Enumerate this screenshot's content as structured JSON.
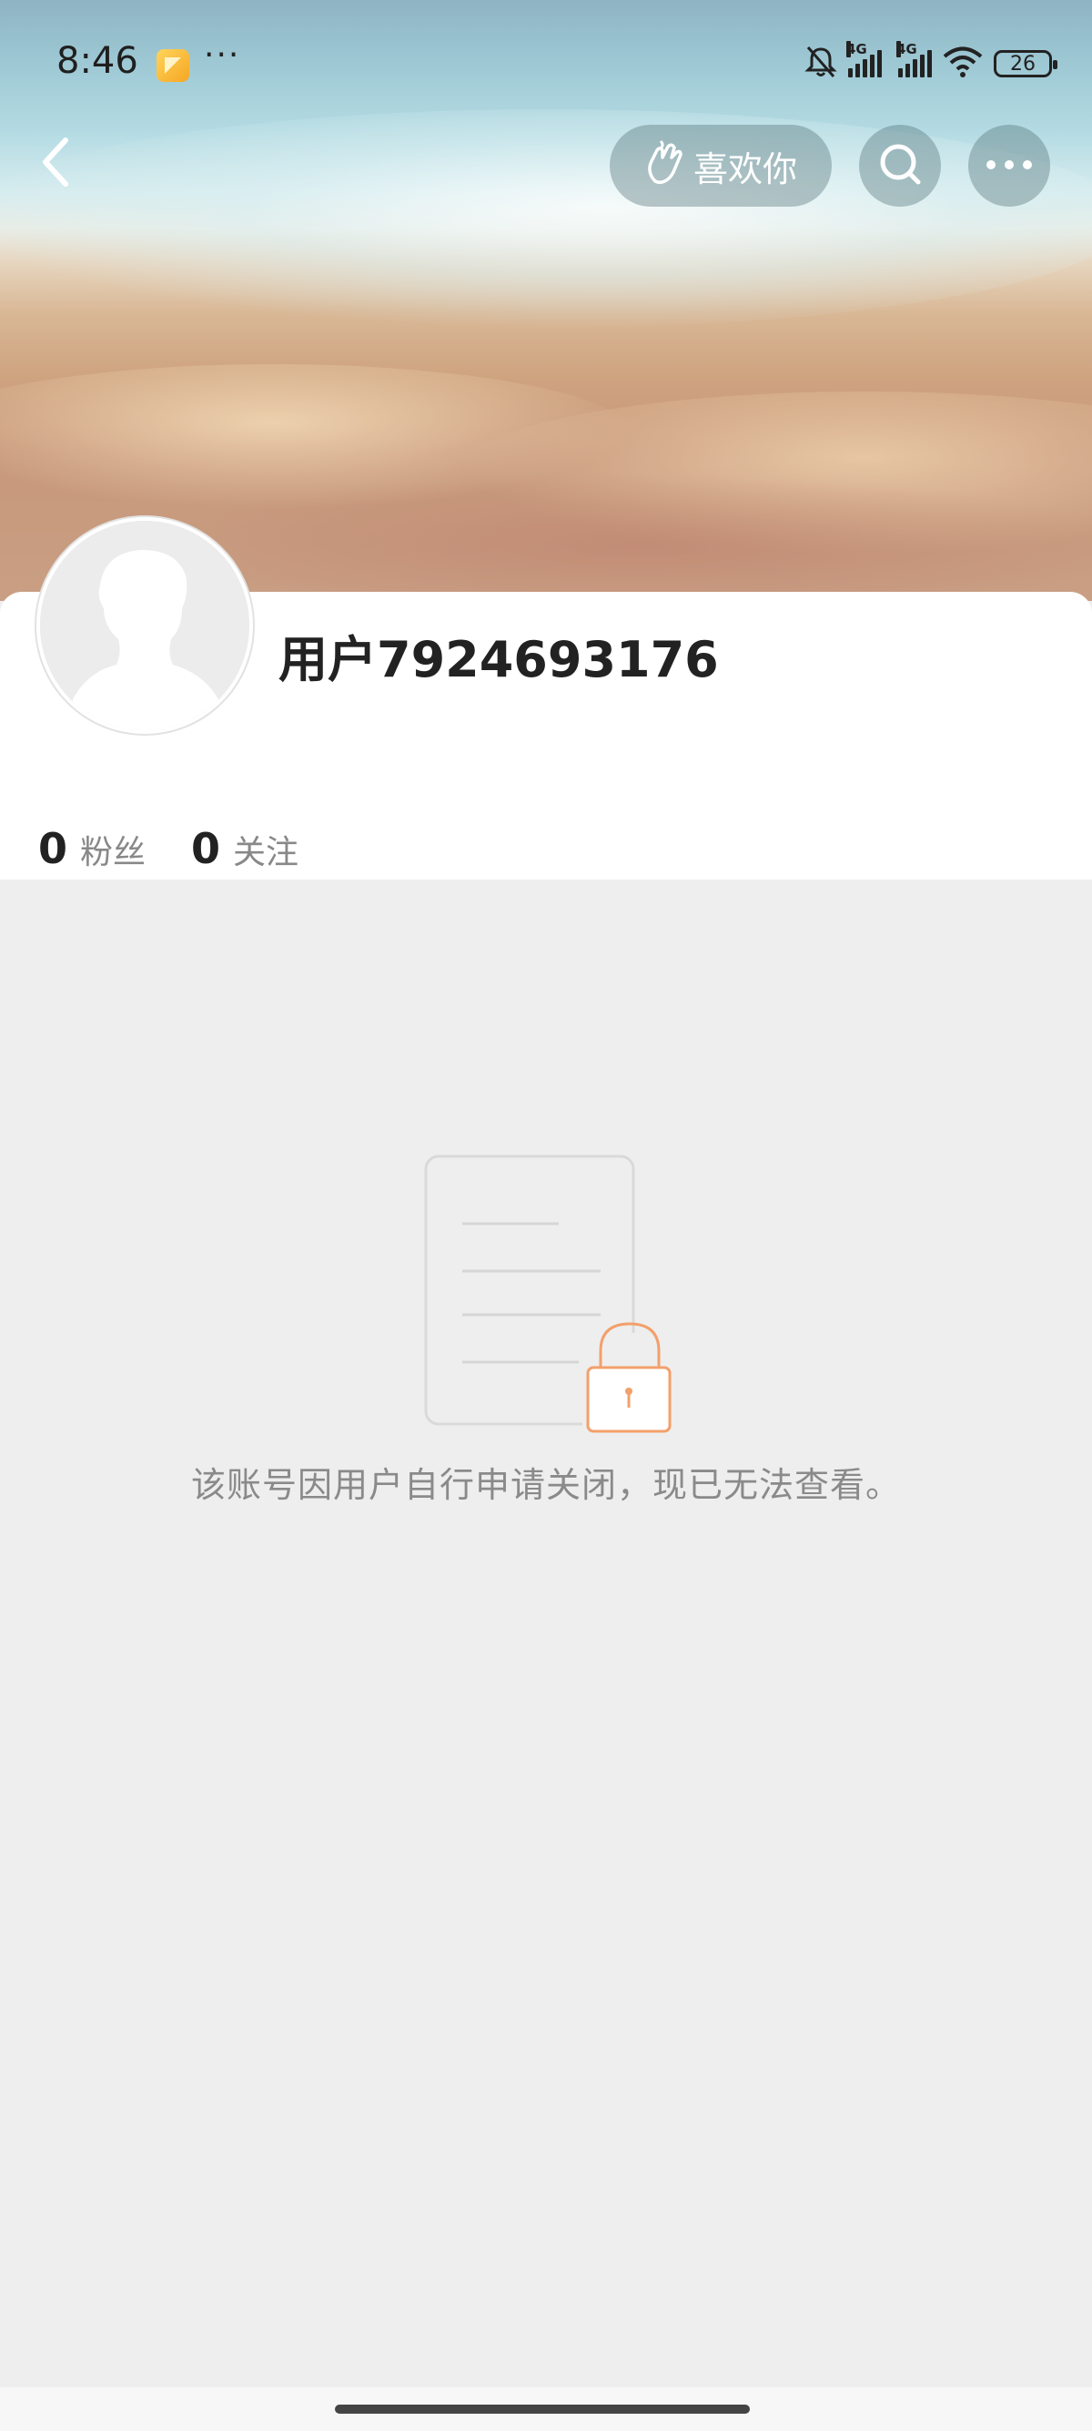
{
  "status_bar": {
    "time": "8:46",
    "dots": "···",
    "network_1": "4G",
    "network_2": "4G",
    "battery": "26"
  },
  "top_nav": {
    "like_label": "喜欢你"
  },
  "profile": {
    "username": "用户7924693176",
    "stats": [
      {
        "value": "0",
        "label": "粉丝"
      },
      {
        "value": "0",
        "label": "关注"
      }
    ]
  },
  "content": {
    "locked_message": "该账号因用户自行申请关闭，现已无法查看。"
  },
  "colors": {
    "accent_lock": "#f3a06b",
    "text_primary": "#222222",
    "text_secondary": "#888888",
    "background": "#eeeeee"
  },
  "icons": [
    "back-arrow-icon",
    "hand-heart-icon",
    "search-icon",
    "more-icon",
    "lock-icon",
    "document-icon",
    "bell-off-icon",
    "wifi-icon",
    "battery-icon"
  ]
}
